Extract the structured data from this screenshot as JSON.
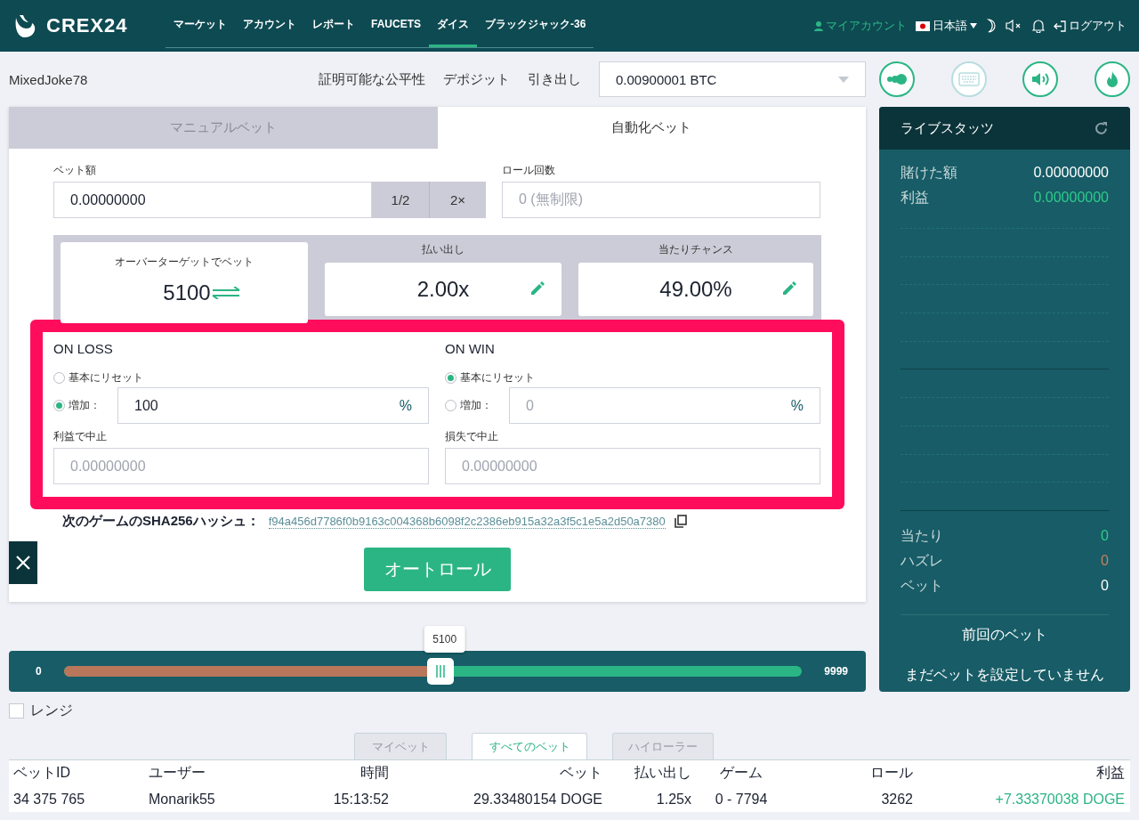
{
  "header": {
    "logo": "CREX24",
    "nav": [
      {
        "label": "マーケット",
        "selected": false
      },
      {
        "label": "アカウント",
        "selected": false
      },
      {
        "label": "レポート",
        "selected": false
      },
      {
        "label": "FAUCETS",
        "selected": false
      },
      {
        "label": "ダイス",
        "selected": true
      },
      {
        "label": "ブラックジャック-36",
        "selected": false
      }
    ],
    "account": "マイアカウント",
    "language": "日本語",
    "logout": "ログアウト"
  },
  "topbar": {
    "username": "MixedJoke78",
    "links": [
      "証明可能な公平性",
      "デポジット",
      "引き出し"
    ],
    "currency": "0.00900001 BTC",
    "tools": [
      {
        "kind": "autobet",
        "disabled": false
      },
      {
        "kind": "keyboard",
        "disabled": true
      },
      {
        "kind": "sound",
        "disabled": false
      },
      {
        "kind": "hot",
        "disabled": false
      }
    ]
  },
  "mode_tabs": [
    {
      "label": "マニュアルベット",
      "selected": false
    },
    {
      "label": "自動化ベット",
      "selected": true
    }
  ],
  "bet_amount": {
    "label": "ベット額",
    "value": "0.00000000",
    "half": "1/2",
    "double": "2×"
  },
  "roll_count": {
    "label": "ロール回数",
    "placeholder": "0 (無制限)"
  },
  "target": {
    "label": "オーバーターゲットでベット",
    "value": "5100"
  },
  "payout": {
    "label": "払い出し",
    "value": "2.00x"
  },
  "chance": {
    "label": "当たりチャンス",
    "value": "49.00%"
  },
  "strategies": [
    {
      "title": "ON LOSS",
      "options": [
        {
          "label": "基本にリセット",
          "selected": false
        },
        {
          "label": "増加：",
          "selected": true,
          "value": "100",
          "suffix": "%"
        }
      ],
      "stop": {
        "label": "利益で中止",
        "placeholder": "0.00000000"
      }
    },
    {
      "title": "ON WIN",
      "options": [
        {
          "label": "基本にリセット",
          "selected": true
        },
        {
          "label": "増加：",
          "selected": false,
          "placeholder": "0",
          "suffix": "%"
        }
      ],
      "stop": {
        "label": "損失で中止",
        "placeholder": "0.00000000"
      }
    }
  ],
  "hash": {
    "label": "次のゲームのSHA256ハッシュ：",
    "value": "f94a456d7786f0b9163c004368b6098f2c2386eb915a32a3f5c1e5a2d50a7380"
  },
  "autoroll": "オートロール",
  "slider": {
    "min": "0",
    "max": "9999",
    "tooltip": "5100",
    "level": 0.51
  },
  "range": {
    "label": "レンジ",
    "checked": false
  },
  "live_stats": {
    "title": "ライブスタッツ",
    "totals": [
      {
        "label": "賭けた額",
        "value": "0.00000000",
        "kind": "plain"
      },
      {
        "label": "利益",
        "value": "0.00000000",
        "kind": "win"
      }
    ],
    "counts": [
      {
        "label": "当たり",
        "value": "0",
        "kind": "win"
      },
      {
        "label": "ハズレ",
        "value": "0",
        "kind": "loss"
      },
      {
        "label": "ベット",
        "value": "0",
        "kind": "plain"
      }
    ],
    "last_bet_title": "前回のベット",
    "last_bet_empty": "まだベットを設定していません"
  },
  "bet_tabs": [
    {
      "label": "マイベット",
      "selected": false
    },
    {
      "label": "すべてのベット",
      "selected": true
    },
    {
      "label": "ハイローラー",
      "selected": false
    }
  ],
  "table": {
    "columns": [
      "ベットID",
      "ユーザー",
      "時間",
      "ベット",
      "払い出し",
      "ゲーム",
      "ロール",
      "利益"
    ],
    "rows": [
      [
        "34 375 765",
        "Monarik55",
        "15:13:52",
        "29.33480154 DOGE",
        "1.25x",
        "0 - 7794",
        "3262",
        "+7.33370038 DOGE"
      ]
    ]
  }
}
